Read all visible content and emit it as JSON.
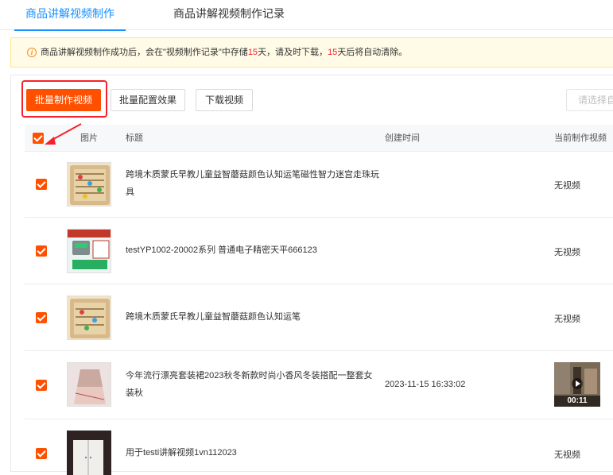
{
  "tabs": [
    {
      "label": "商品讲解视频制作"
    },
    {
      "label": "商品讲解视频制作记录"
    }
  ],
  "notice": {
    "part1": "商品讲解视频制作成功后，会在\"视频制作记录\"中存储",
    "days1": "15",
    "part2": "天，请及时下载，",
    "days2": "15",
    "part3": "天后将自动清除。"
  },
  "toolbar": {
    "batch_make": "批量制作视频",
    "batch_config": "批量配置效果",
    "download": "下载视频",
    "select_placeholder": "请选择自"
  },
  "table": {
    "headers": {
      "image": "图片",
      "title": "标题",
      "created": "创建时间",
      "current_video": "当前制作视频"
    },
    "rows": [
      {
        "title": "跨境木质蒙氏早教儿童益智蘑菇颜色认知运笔磁性智力迷宫走珠玩具",
        "created": "",
        "video": "无视频",
        "thumb": "maze-toy"
      },
      {
        "title": "testYP1002-20002系列 普通电子精密天平666123",
        "created": "",
        "video": "无视频",
        "thumb": "balance-scale"
      },
      {
        "title": "跨境木质蒙氏早教儿童益智蘑菇颜色认知运笔",
        "created": "",
        "video": "无视频",
        "thumb": "maze-toy"
      },
      {
        "title": "今年流行漂亮套装裙2023秋冬新款时尚小香风冬装搭配一整套女装秋",
        "created": "2023-11-15 16:33:02",
        "video": "",
        "video_duration": "00:11",
        "thumb": "dress"
      },
      {
        "title": "用于testi讲解视频1vn112023",
        "created": "",
        "video": "无视频",
        "thumb": "cabinet"
      }
    ]
  },
  "colors": {
    "accent": "#ff5000",
    "tab_active": "#1890ff",
    "highlight": "#f5222d"
  }
}
